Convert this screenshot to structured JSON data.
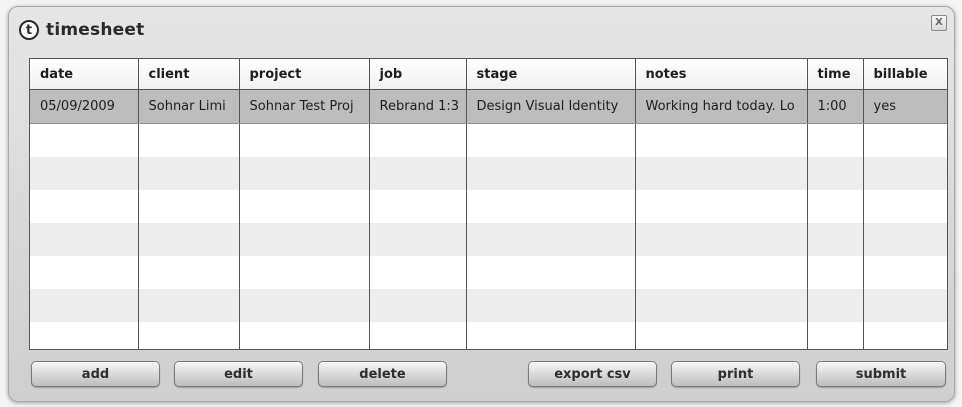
{
  "window": {
    "logo_letter": "t",
    "title": "timesheet",
    "close_label": "X"
  },
  "grid": {
    "columns": [
      "date",
      "client",
      "project",
      "job",
      "stage",
      "notes",
      "time",
      "billable"
    ],
    "rows": [
      {
        "date": "05/09/2009",
        "client": "Sohnar Limi",
        "project": "Sohnar Test Proj",
        "job": "Rebrand 1:3",
        "stage": "Design Visual Identity",
        "notes": "Working hard today. Lo",
        "time": "1:00",
        "billable": "yes"
      }
    ],
    "empty_row_count": 7
  },
  "buttons": {
    "add": "add",
    "edit": "edit",
    "delete": "delete",
    "export_csv": "export csv",
    "print": "print",
    "submit": "submit"
  },
  "colors": {
    "selected_row": "#bdbdbd",
    "alt_row": "#ededed",
    "window_bg": "#d9d9d9"
  }
}
